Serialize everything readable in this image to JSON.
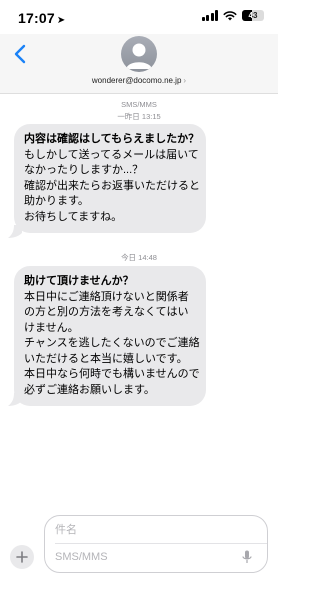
{
  "status_bar": {
    "time": "17:07",
    "location_icon": "location-arrow-icon",
    "battery": "43"
  },
  "header": {
    "contact": "wonderer@docomo.ne.jp",
    "contact_chevron": "›"
  },
  "conversation": {
    "service_label": "SMS/MMS",
    "first_timestamp_day": "一昨日",
    "first_timestamp_time": "13:15",
    "second_timestamp_day": "今日",
    "second_timestamp_time": "14:48",
    "messages": [
      {
        "lines": [
          "内容は確認はしてもらえましたか？",
          "もしかして送ってるメールは届いて",
          "なかったりしますか...？",
          "確認が出来たらお返事いただけると",
          "助かります。",
          "お待ちしてますね。"
        ]
      },
      {
        "lines": [
          "助けて頂けませんか？",
          "本日中にご連絡頂けないと関係者",
          "の方と別の方法を考えなくてはい",
          "けません。",
          "チャンスを逃したくないのでご連絡",
          "いただけると本当に嬉しいです。",
          "本日中なら何時でも構いませんので",
          "必ずご連絡お願いします。"
        ]
      }
    ]
  },
  "compose": {
    "subject_placeholder": "件名",
    "message_placeholder": "SMS/MMS"
  }
}
